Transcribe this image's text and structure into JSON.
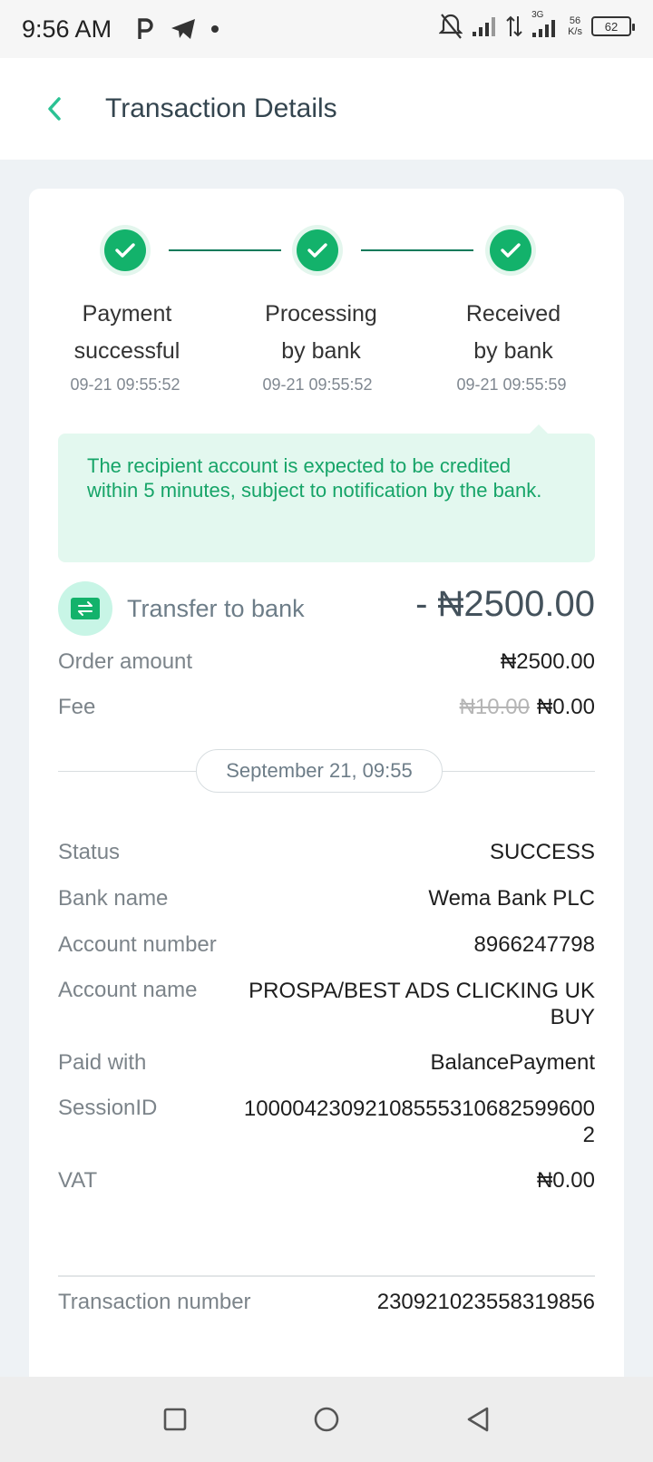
{
  "status_bar": {
    "time": "9:56 AM",
    "net_speed_value": "56",
    "net_speed_unit": "K/s",
    "battery": "62",
    "network_type": "3G"
  },
  "header": {
    "title": "Transaction Details"
  },
  "progress": {
    "steps": [
      {
        "label": "Payment\nsuccessful",
        "time": "09-21 09:55:52"
      },
      {
        "label": "Processing\nby bank",
        "time": "09-21 09:55:52"
      },
      {
        "label": "Received\nby bank",
        "time": "09-21 09:55:59"
      }
    ]
  },
  "notice": "The recipient account is expected to be credited within 5 minutes, subject to notification by the bank.",
  "transfer": {
    "label": "Transfer to bank",
    "amount": "- ₦2500.00"
  },
  "summary": {
    "order_amount_label": "Order amount",
    "order_amount_value": "₦2500.00",
    "fee_label": "Fee",
    "fee_original": "₦10.00",
    "fee_value": "₦0.00"
  },
  "date_divider": "September 21, 09:55",
  "details": [
    {
      "label": "Status",
      "value": "SUCCESS"
    },
    {
      "label": "Bank name",
      "value": "Wema Bank PLC"
    },
    {
      "label": "Account number",
      "value": "8966247798"
    },
    {
      "label": "Account name",
      "value": "PROSPA/BEST ADS CLICKING UK BUY"
    },
    {
      "label": "Paid with",
      "value": "BalancePayment"
    },
    {
      "label": "SessionID",
      "value": "100004230921085553106825996002"
    },
    {
      "label": "VAT",
      "value": "₦0.00"
    }
  ],
  "transaction_number": {
    "label": "Transaction number",
    "value": "230921023558319856"
  },
  "colors": {
    "accent": "#13b26b",
    "notice_bg": "#e3f8ef",
    "notice_text": "#16a468"
  }
}
